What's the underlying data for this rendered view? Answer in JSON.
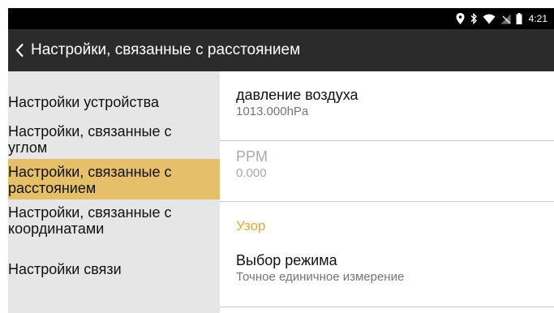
{
  "status_bar": {
    "icons": [
      "location-icon",
      "bluetooth-icon",
      "wifi-icon",
      "no-sim-icon",
      "battery-icon"
    ],
    "time": "4:21"
  },
  "app_bar": {
    "back_icon": "chevron-left-icon",
    "title": "Настройки, связанные с расстоянием"
  },
  "sidebar": {
    "items": [
      {
        "label": "Настройки устройства"
      },
      {
        "label_line1": "Настройки, связанные с",
        "label_line2": "углом"
      },
      {
        "label_line1": "Настройки, связанные с",
        "label_line2": "расстоянием",
        "selected": true
      },
      {
        "label_line1": "Настройки, связанные с",
        "label_line2": "координатами"
      },
      {
        "label": "Настройки связи"
      }
    ]
  },
  "content": {
    "air_pressure": {
      "title": "давление воздуха",
      "value": "1013.000hPa"
    },
    "ppm": {
      "title": "PPM",
      "value": "0.000",
      "enabled": false
    },
    "pattern_category": "Узор",
    "mode_select": {
      "title": "Выбор режима",
      "value": "Точное единичное измерение"
    }
  },
  "colors": {
    "status_bar": "#000000",
    "app_bar": "#2b2b2b",
    "sidebar_bg": "#e6e6e6",
    "sidebar_selected": "#e6bf6a",
    "category_accent": "#e2a93b",
    "divider": "#cccccc"
  }
}
